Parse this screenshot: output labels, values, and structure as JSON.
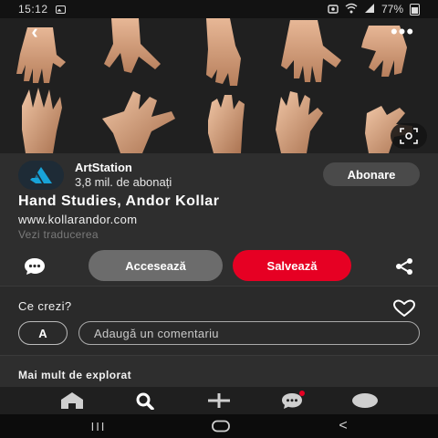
{
  "status_bar": {
    "time": "15:12",
    "battery_text": "77%",
    "icons": [
      "gallery-icon",
      "alarm-icon",
      "wifi-icon",
      "signal-icon",
      "battery-icon"
    ]
  },
  "hero": {
    "image_icon": "hand-studies-image",
    "top_controls": [
      "back-arrow-icon",
      "more-options-icon"
    ],
    "lens_icon": "visual-search-icon"
  },
  "creator": {
    "name": "ArtStation",
    "followers": "3,8 mil. de abonați",
    "follow_label": "Abonare",
    "logo_icon": "artstation-logo"
  },
  "pin": {
    "title": "Hand Studies, Andor Kollar",
    "link": "www.kollarandor.com",
    "translate_label": "Vezi traducerea"
  },
  "actions": {
    "comment_icon": "comment-bubble-icon",
    "visit_label": "Accesează",
    "save_label": "Salvează",
    "share_icon": "share-icon"
  },
  "comments": {
    "heading": "Ce crezi?",
    "avatar_initial": "A",
    "input_placeholder": "Adaugă un comentariu",
    "heart_icon": "heart-icon"
  },
  "more": {
    "heading": "Mai mult de explorat"
  },
  "bottom_nav": {
    "items": [
      "home-icon",
      "search-icon",
      "plus-icon",
      "messages-icon",
      "profile-icon"
    ]
  },
  "system_nav": {
    "recents": "III",
    "back": "<"
  },
  "colors": {
    "save_red": "#e60023",
    "visit_gray": "#6c6c6c",
    "background": "#2e2e2e"
  }
}
